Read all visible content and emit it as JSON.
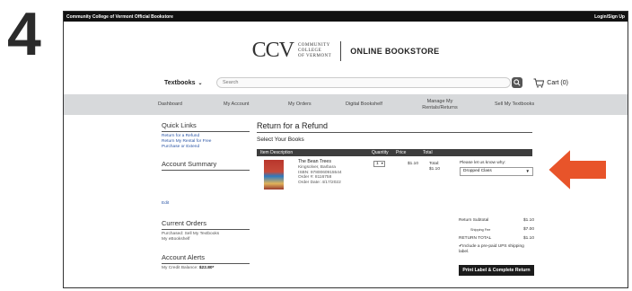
{
  "step": "4",
  "topbar": {
    "left_text": "Community College of Vermont Official Bookstore",
    "login": "Login/Sign Up"
  },
  "brand": {
    "logo_mark": "CCV",
    "logo_lines": [
      "COMMUNITY",
      "COLLEGE",
      "OF VERMONT"
    ],
    "store_title": "ONLINE BOOKSTORE"
  },
  "search": {
    "menu_label": "Textbooks",
    "placeholder": "Search"
  },
  "cart": {
    "label": "Cart (0)"
  },
  "nav": [
    {
      "label": "Dashboard"
    },
    {
      "label": "My Account"
    },
    {
      "label": "My Orders"
    },
    {
      "label": "Digital Bookshelf"
    },
    {
      "label": "Manage My Rentals/Returns"
    },
    {
      "label": "Sell My Textbooks"
    }
  ],
  "sidebar": {
    "quick_links_heading": "Quick Links",
    "quick_links": [
      "Return for a Refund",
      "Return My Rental for Free",
      "Purchase or Extend"
    ],
    "account_summary_heading": "Account Summary",
    "edit_link": "Edit",
    "current_orders_heading": "Current Orders",
    "current_orders_lines": [
      "Purchased: Sell My Textbooks",
      "My eBookshelf"
    ],
    "alerts_heading": "Account Alerts",
    "credit_label": "My Credit Balance:",
    "credit_value": "$22.80*"
  },
  "main": {
    "title": "Return for a Refund",
    "subtitle": "Select Your Books",
    "columns": {
      "item": "Item Description",
      "quantity": "Quantity",
      "price": "Price",
      "total": "Total"
    },
    "book": {
      "title": "The Bean Trees",
      "author": "Kingsolver, Barbara",
      "isbn": "ISBN: 9780060915544",
      "order": "Order #: 8116758",
      "order_date": "Order Date: 4/17/2022",
      "quantity": "1",
      "price": "$1.10",
      "total_label": "Total:",
      "total_value": "$1.10"
    },
    "reason_label": "Please let us know why:",
    "reason_selected": "Dropped Class",
    "summary": {
      "subtotal_label": "Return Subtotal",
      "subtotal_value": "$1.10",
      "shipping_label": "Shipping Fee",
      "shipping_value": "$7.00",
      "total_label": "RETURN TOTAL",
      "total_value": "$1.10",
      "ups_text": "Include a pre-paid UPS shipping label."
    },
    "print_button": "Print Label & Complete Return"
  },
  "colors": {
    "arrow": "#e8542a",
    "header_bg": "#111111",
    "nav_bg": "#d7d9db"
  }
}
